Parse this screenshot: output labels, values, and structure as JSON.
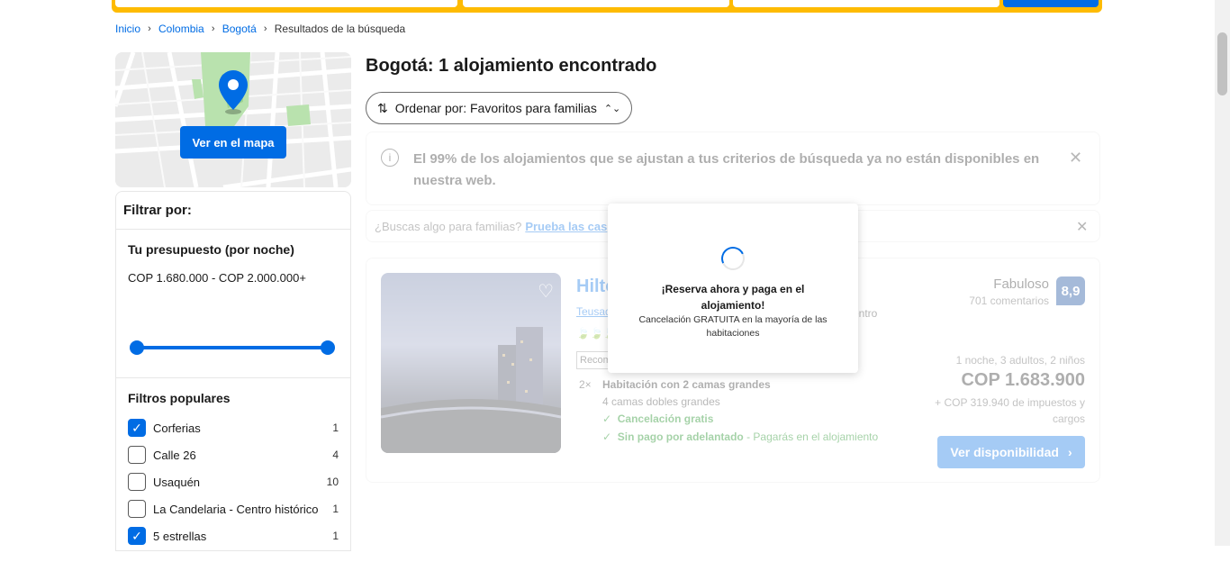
{
  "breadcrumb": {
    "items": [
      "Inicio",
      "Colombia",
      "Bogotá"
    ],
    "current": "Resultados de la búsqueda"
  },
  "map": {
    "button_label": "Ver en el mapa"
  },
  "filters": {
    "title": "Filtrar por:",
    "budget": {
      "title": "Tu presupuesto (por noche)",
      "range": "COP 1.680.000 - COP 2.000.000+"
    },
    "popular": {
      "title": "Filtros populares",
      "items": [
        {
          "label": "Corferias",
          "count": "1",
          "checked": true
        },
        {
          "label": "Calle 26",
          "count": "4",
          "checked": false
        },
        {
          "label": "Usaquén",
          "count": "10",
          "checked": false
        },
        {
          "label": "La Candelaria - Centro histórico",
          "count": "1",
          "checked": false
        },
        {
          "label": "5 estrellas",
          "count": "1",
          "checked": true
        }
      ]
    }
  },
  "results": {
    "title": "Bogotá: 1 alojamiento encontrado",
    "sort_label": "Ordenar por: Favoritos para familias",
    "notice": "El 99% de los alojamientos que se ajustan a tus criterios de búsqueda ya no están disponibles en nuestra web.",
    "family_text": "¿Buscas algo para familias?",
    "family_link": "Prueba las cas"
  },
  "hotel": {
    "name": "Hilto",
    "location": "Teusaq",
    "location_suffix": "entro",
    "recommended": "Recom",
    "room_qty": "2×",
    "room_name": "Habitación con 2 camas grandes",
    "beds": "4 camas dobles grandes",
    "cancel": "Cancelación gratis",
    "nopay": "Sin pago por adelantado",
    "nopay_suffix": " - Pagarás en el alojamiento",
    "score_word": "Fabuloso",
    "reviews": "701 comentarios",
    "score": "8,9",
    "stay": "1 noche, 3 adultos, 2 niños",
    "price": "COP 1.683.900",
    "taxes": "+ COP 319.940 de impuestos y cargos",
    "button": "Ver disponibilidad"
  },
  "popup": {
    "title": "¡Reserva ahora y paga en el alojamiento!",
    "subtitle": "Cancelación GRATUITA en la mayoría de las habitaciones"
  },
  "colors": {
    "primary": "#006ce4",
    "accent": "#febb02",
    "score_badge": "#003b95",
    "success": "#008009"
  }
}
